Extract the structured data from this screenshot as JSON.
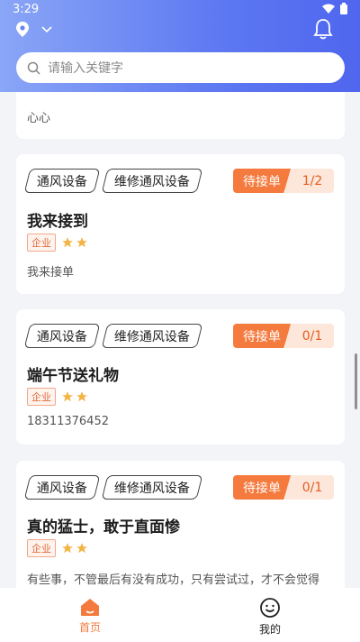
{
  "status_bar": {
    "time": "3:29"
  },
  "search": {
    "placeholder": "请输入关键字"
  },
  "cards": [
    {
      "desc": "心心"
    },
    {
      "tag1": "通风设备",
      "tag2": "维修通风设备",
      "status": "待接单",
      "count": "1/2",
      "title": "我来接到",
      "badge": "企业",
      "desc": "我来接单"
    },
    {
      "tag1": "通风设备",
      "tag2": "维修通风设备",
      "status": "待接单",
      "count": "0/1",
      "title": "端午节送礼物",
      "badge": "企业",
      "desc": "18311376452"
    },
    {
      "tag1": "通风设备",
      "tag2": "维修通风设备",
      "status": "待接单",
      "count": "0/1",
      "title": "真的猛士，敢于直面惨",
      "badge": "企业",
      "desc": "有些事，不管最后有没有成功，只有尝试过，才不会觉得"
    }
  ],
  "nav": {
    "home": "首页",
    "mine": "我的"
  },
  "colors": {
    "accent": "#f47a3d",
    "header": "#5e79f2"
  },
  "icons": [
    "location-icon",
    "chevron-down-icon",
    "bell-icon",
    "search-icon",
    "star-icon",
    "home-icon",
    "smile-icon"
  ]
}
